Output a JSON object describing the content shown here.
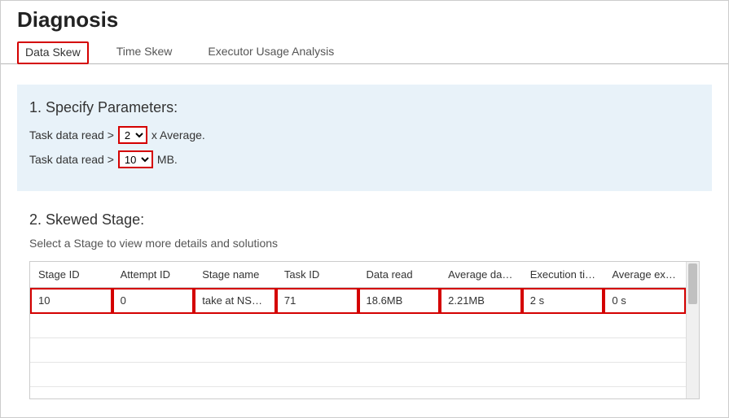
{
  "title": "Diagnosis",
  "tabs": [
    {
      "label": "Data Skew",
      "active": true
    },
    {
      "label": "Time Skew",
      "active": false
    },
    {
      "label": "Executor Usage Analysis",
      "active": false
    }
  ],
  "params": {
    "title": "1. Specify Parameters:",
    "line1_prefix": "Task data read >",
    "line1_select": "2",
    "line1_suffix": "x Average.",
    "line2_prefix": "Task data read >",
    "line2_select": "10",
    "line2_suffix": "MB."
  },
  "skewed": {
    "title": "2. Skewed Stage:",
    "subtitle": "Select a Stage to view more details and solutions",
    "columns": [
      "Stage ID",
      "Attempt ID",
      "Stage name",
      "Task ID",
      "Data read",
      "Average dat…",
      "Execution time",
      "Average exe…"
    ],
    "rows": [
      {
        "stage_id": "10",
        "attempt_id": "0",
        "stage_name": "take at NSer…",
        "task_id": "71",
        "data_read": "18.6MB",
        "avg_data": "2.21MB",
        "exec_time": "2 s",
        "avg_exec": "0 s"
      }
    ]
  }
}
